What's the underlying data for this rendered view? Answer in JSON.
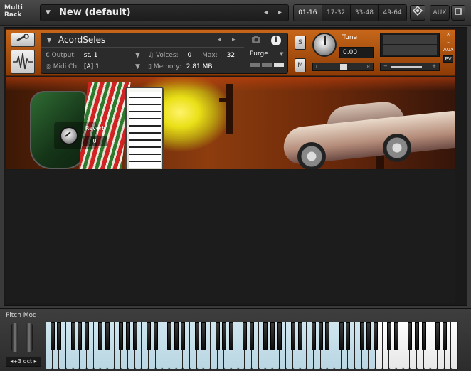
{
  "topbar": {
    "multi_rack_label_1": "Multi",
    "multi_rack_label_2": "Rack",
    "rack_title": "New (default)",
    "prev_arrow": "◂",
    "next_arrow": "▸",
    "pages": [
      "01-16",
      "17-32",
      "33-48",
      "49-64"
    ],
    "active_page": "01-16",
    "aux_label": "AUX"
  },
  "instrument": {
    "name": "AcordSeles",
    "output_label": "Output:",
    "output_value": "st. 1",
    "voices_label": "Voices:",
    "voices_value": "0",
    "max_label": "Max:",
    "max_value": "32",
    "midi_label": "Midi Ch:",
    "midi_value": "[A] 1",
    "memory_label": "Memory:",
    "memory_value": "2.81 MB",
    "purge_label": "Purge",
    "solo_label": "S",
    "mute_label": "M",
    "tune_label": "Tune",
    "tune_value": "0.00",
    "pan_left": "L",
    "pan_right": "R",
    "vol_minus": "−",
    "vol_plus": "+",
    "close_label": "×",
    "min_label": "–",
    "aux_label": "AUX",
    "pv_label": "PV"
  },
  "artwork": {
    "reverb_label": "Reverb",
    "reverb_value": "0"
  },
  "keyboard": {
    "pitch_mod_label": "Pitch Mod",
    "octave_label": "◂+3 oct ▸",
    "white_keys": 60,
    "highlight_from_white_key": 48
  },
  "colors": {
    "header_orange": "#c6671a",
    "key_blue": "#cfe6ef",
    "key_white": "#ffffff"
  }
}
